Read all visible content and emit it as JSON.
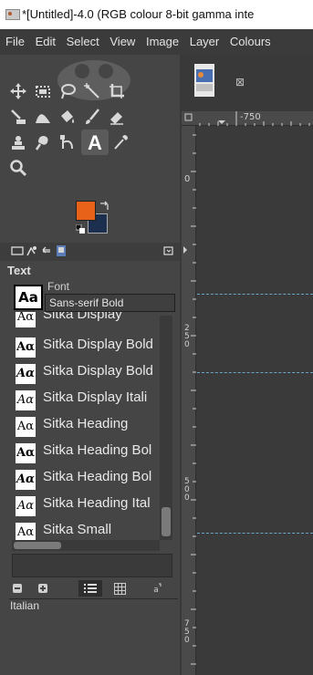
{
  "window": {
    "title": "*[Untitled]-4.0 (RGB colour 8-bit gamma inte"
  },
  "menu": [
    "File",
    "Edit",
    "Select",
    "View",
    "Image",
    "Layer",
    "Colours"
  ],
  "toolbox": {
    "tools": [
      [
        "move-icon",
        "rect-select-icon",
        "lasso-icon",
        "fuzzy-select-icon",
        "crop-icon"
      ],
      [
        "unified-transform-icon",
        "warp-transform-icon",
        "bucket-fill-icon",
        "paintbrush-icon",
        "eraser-icon"
      ],
      [
        "clone-icon",
        "smudge-icon",
        "paths-icon",
        "text-icon",
        "color-picker-icon"
      ],
      [
        "zoom-icon"
      ]
    ],
    "fg_color": "#e8621a",
    "bg_color": "#1d2f4f"
  },
  "text_panel": {
    "title": "Text",
    "font_label": "Font",
    "font_preview": "Aa",
    "font_value": "Sans-serif Bold",
    "fonts": [
      {
        "icon": "Aα",
        "label": "Sitka Display",
        "style": "thin"
      },
      {
        "icon": "Aα",
        "label": "Sitka Display Bold",
        "style": "bold"
      },
      {
        "icon": "Aα",
        "label": "Sitka Display Bold",
        "style": "bold-italic"
      },
      {
        "icon": "Aα",
        "label": "Sitka Display Itali",
        "style": "italic"
      },
      {
        "icon": "Aα",
        "label": "Sitka Heading",
        "style": "thin"
      },
      {
        "icon": "Aα",
        "label": "Sitka Heading Bol",
        "style": "bold"
      },
      {
        "icon": "Aα",
        "label": "Sitka Heading Bol",
        "style": "bold-italic"
      },
      {
        "icon": "Aα",
        "label": "Sitka Heading Ital",
        "style": "italic"
      },
      {
        "icon": "Aα",
        "label": "Sitka Small",
        "style": "thin"
      }
    ],
    "status": "Italian"
  },
  "canvas": {
    "ruler_top_label": "-750",
    "ruler_left_labels": [
      "0",
      "250",
      "500",
      "750"
    ]
  }
}
